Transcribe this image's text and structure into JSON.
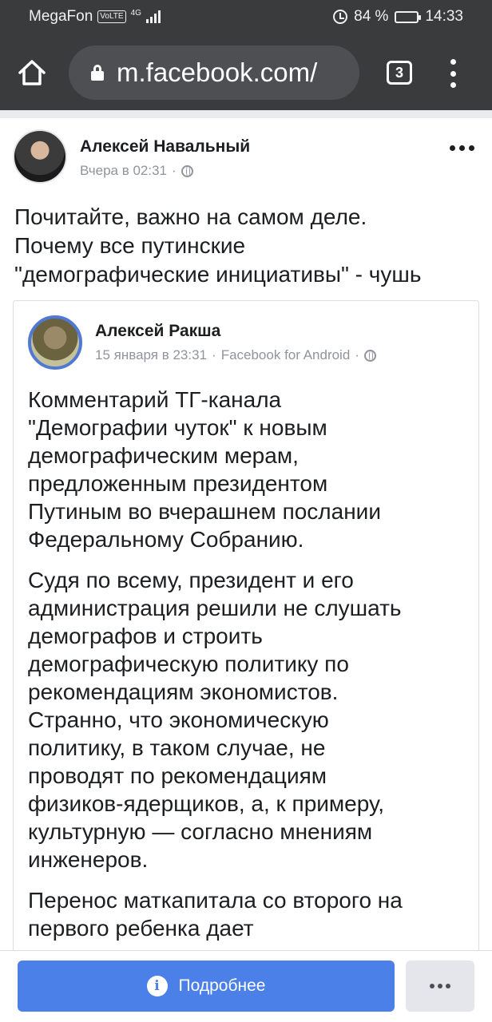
{
  "status_bar": {
    "carrier": "MegaFon",
    "volte": "VoLTE",
    "network": "4G",
    "battery": "84 %",
    "battery_level": 0.84,
    "time": "14:33"
  },
  "browser": {
    "url": "m.facebook.com/",
    "tab_count": "3"
  },
  "post": {
    "author": "Алексей Навальный",
    "time": "Вчера в 02:31",
    "text_lines": [
      "Почитайте, важно на самом деле.",
      "Почему все путинские",
      "\"демографические инициативы\" - чушь"
    ]
  },
  "shared_post": {
    "author": "Алексей Ракша",
    "time": "15 января в 23:31",
    "source": "Facebook for Android",
    "paragraphs": [
      [
        "Комментарий ТГ-канала",
        "\"Демографии чуток\" к новым",
        "демографическим мерам,",
        "предложенным президентом",
        "Путиным во вчерашнем послании",
        "Федеральному Собранию."
      ],
      [
        "Судя по всему, президент и его",
        "администрация решили не слушать",
        "демографов и строить",
        "демографическую политику по",
        "рекомендациям экономистов.",
        "Странно, что экономическую",
        "политику, в таком случае, не",
        "проводят по рекомендациям",
        "физиков-ядерщиков, а, к примеру,",
        "культурную — согласно мнениям",
        "инженеров."
      ],
      [
        "Перенос маткапитала со второго на",
        "первого ребенка дает"
      ]
    ]
  },
  "bottom_bar": {
    "primary_label": "Подробнее"
  },
  "colors": {
    "chrome": "#3a3b3d",
    "accent": "#4a80e8",
    "secondary_text": "#90949c"
  }
}
